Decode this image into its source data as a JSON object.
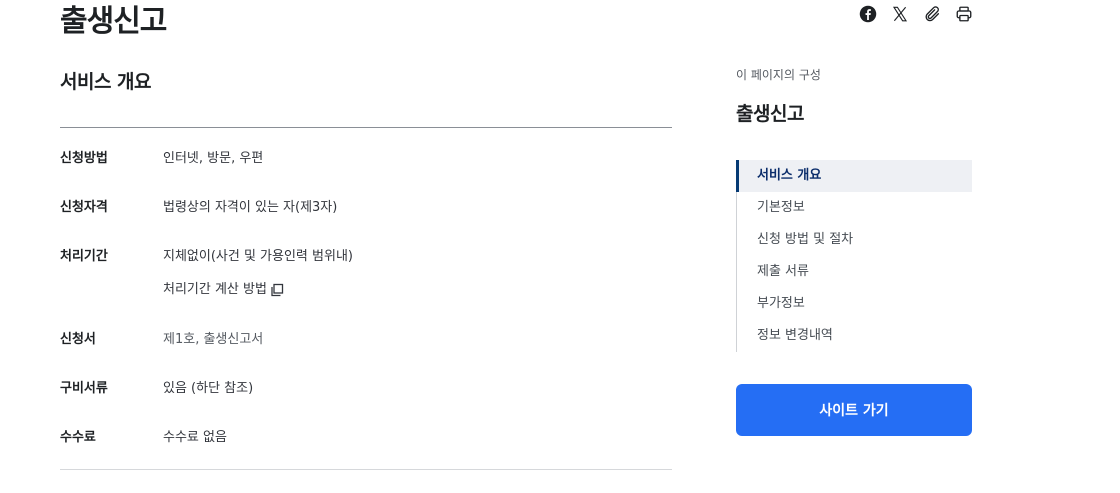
{
  "header": {
    "title": "출생신고",
    "share": [
      {
        "icon": "facebook-icon"
      },
      {
        "icon": "x-icon"
      },
      {
        "icon": "link-icon"
      },
      {
        "icon": "print-icon"
      }
    ]
  },
  "overview": {
    "title": "서비스 개요",
    "rows": [
      {
        "label": "신청방법",
        "value": "인터넷, 방문, 우편"
      },
      {
        "label": "신청자격",
        "value": "법령상의 자격이 있는 자(제3자)"
      },
      {
        "label": "처리기간",
        "value": "지체없이(사건 및 가용인력 범위내)",
        "link": "처리기간 계산 방법"
      },
      {
        "label": "신청서",
        "value": "제1호, 출생신고서"
      },
      {
        "label": "구비서류",
        "value": "있음 (하단 참조)"
      },
      {
        "label": "수수료",
        "value": "수수료 없음"
      }
    ]
  },
  "toc": {
    "caption": "이 페이지의 구성",
    "title": "출생신고",
    "items": [
      "서비스 개요",
      "기본정보",
      "신청 방법 및 절차",
      "제출 서류",
      "부가정보",
      "정보 변경내역"
    ],
    "active_index": 0
  },
  "site_button": {
    "label": "사이트 가기",
    "color": "#256ef4"
  }
}
